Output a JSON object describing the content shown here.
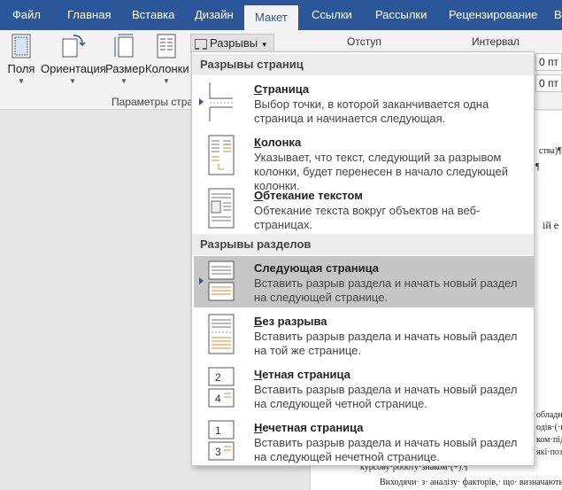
{
  "tabs": [
    "Файл",
    "Главная",
    "Вставка",
    "Дизайн",
    "Макет",
    "Ссылки",
    "Рассылки",
    "Рецензирование",
    "В"
  ],
  "active_tab": "Макет",
  "ribbon": {
    "buttons": [
      "Поля",
      "Ориентация",
      "Размер",
      "Колонки"
    ],
    "breaks_label": "Разрывы",
    "group_label": "Параметры стра",
    "indent_label": "Отступ",
    "interval_label": "Интервал",
    "spin1_value": "0 пт",
    "spin2_value": "0 пт"
  },
  "menu": {
    "section_page_breaks": "Разрывы страниц",
    "section_section_breaks": "Разрывы разделов",
    "items": [
      {
        "title_ul": "С",
        "title_rest": "траница",
        "desc": "Выбор точки, в которой заканчивается одна страница и начинается следующая."
      },
      {
        "title_ul": "К",
        "title_rest": "олонка",
        "desc": "Указывает, что текст, следующий за разрывом колонки, будет перенесен в начало следующей колонки."
      },
      {
        "title_ul": "О",
        "title_rest": "бтекание текстом",
        "desc": "Обтекание текста вокруг объектов на веб-страницах."
      },
      {
        "title_ul": "",
        "title_rest": "Следующая страница",
        "desc": "Вставить разрыв раздела и начать новый раздел на следующей странице."
      },
      {
        "title_ul": "Б",
        "title_rest": "ез разрыва",
        "desc": "Вставить разрыв раздела и начать новый раздел на той же странице."
      },
      {
        "title_ul": "Ч",
        "title_rest": "етная страница",
        "desc": "Вставить разрыв раздела и начать новый раздел на следующей четной странице."
      },
      {
        "title_ul": "Н",
        "title_rest": "ечетная страница",
        "desc": "Вставить разрыв раздела и начать новый раздел на следующей нечетной странице."
      }
    ]
  },
  "doc": {
    "frag1": "ства)¶",
    "frag2": "¶",
    "frag3": "ій е",
    "frag4": "обладн",
    "frag5": "одів·(·н",
    "frag6": "ком·підп",
    "frag7": "які·поз",
    "line1": "курсову·роботу·знаком·(+).¶",
    "line2": "Виходячи· з· аналізу· факторів,· що· визначають· п"
  },
  "colors": {
    "accent": "#2b579a",
    "highlight": "#c6c6c6"
  }
}
